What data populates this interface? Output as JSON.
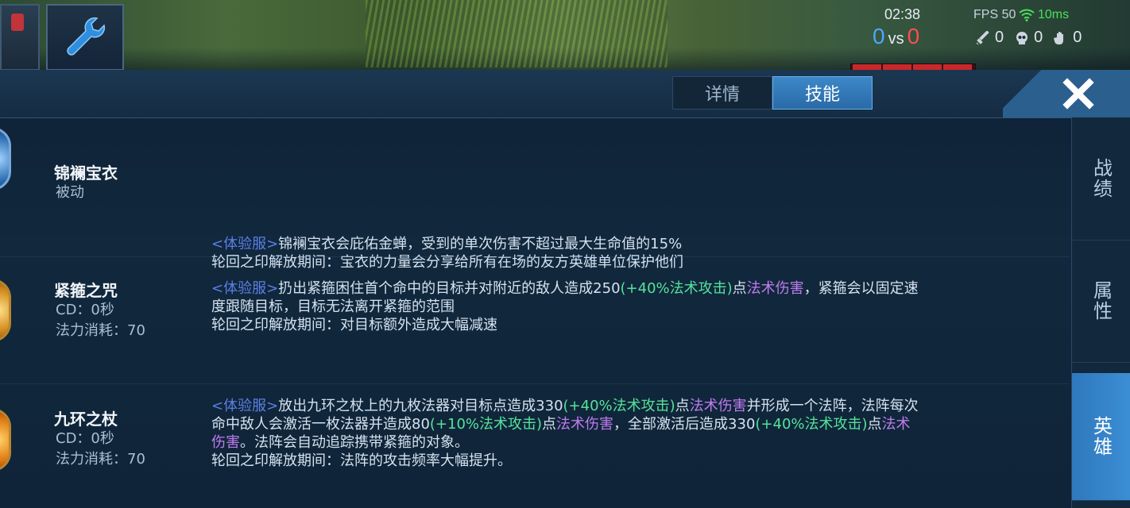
{
  "hud": {
    "time": "02:38",
    "fps": "FPS 50",
    "ping": "10ms",
    "score_blue": "0",
    "score_vs": "vs",
    "score_red": "0",
    "kills": "0",
    "deaths": "0",
    "assists": "0"
  },
  "tabs": {
    "details": "详情",
    "skills": "技能"
  },
  "side_tabs": {
    "record": "战绩",
    "attributes": "属性",
    "hero": "英雄"
  },
  "skills": [
    {
      "name": "锦襕宝衣",
      "type": "被动",
      "desc": [
        [
          {
            "t": "<体验服>",
            "c": "tag"
          },
          {
            "t": "锦襕宝衣会庇佑金蝉，受到的单次伤害不超过最大生命值的15%",
            "c": ""
          }
        ],
        [
          {
            "t": "轮回之印解放期间：宝衣的力量会分享给所有在场的友方英雄单位保护他们",
            "c": ""
          }
        ]
      ]
    },
    {
      "name": "紧箍之咒",
      "cd": "CD：0秒",
      "cost": "法力消耗：70",
      "desc": [
        [
          {
            "t": "<体验服>",
            "c": "tag"
          },
          {
            "t": "扔出紧箍困住首个命中的目标并对附近的敌人造成250",
            "c": ""
          },
          {
            "t": "(+40%法术攻击)",
            "c": "grn"
          },
          {
            "t": "点",
            "c": ""
          },
          {
            "t": "法术伤害",
            "c": "pur"
          },
          {
            "t": "，紧箍会以固定速",
            "c": ""
          }
        ],
        [
          {
            "t": "度跟随目标，目标无法离开紧箍的范围",
            "c": ""
          }
        ],
        [
          {
            "t": "轮回之印解放期间：对目标额外造成大幅减速",
            "c": ""
          }
        ]
      ]
    },
    {
      "name": "九环之杖",
      "cd": "CD：0秒",
      "cost": "法力消耗：70",
      "desc": [
        [
          {
            "t": "<体验服>",
            "c": "tag"
          },
          {
            "t": "放出九环之杖上的九枚法器对目标点造成330",
            "c": ""
          },
          {
            "t": "(+40%法术攻击)",
            "c": "grn"
          },
          {
            "t": "点",
            "c": ""
          },
          {
            "t": "法术伤害",
            "c": "pur"
          },
          {
            "t": "并形成一个法阵，法阵每次",
            "c": ""
          }
        ],
        [
          {
            "t": "命中敌人会激活一枚法器并造成80",
            "c": ""
          },
          {
            "t": "(+10%法术攻击)",
            "c": "grn"
          },
          {
            "t": "点",
            "c": ""
          },
          {
            "t": "法术伤害",
            "c": "pur"
          },
          {
            "t": "，全部激活后造成330",
            "c": ""
          },
          {
            "t": "(+40%法术攻击)",
            "c": "grn"
          },
          {
            "t": "点",
            "c": ""
          },
          {
            "t": "法术",
            "c": "pur"
          }
        ],
        [
          {
            "t": "伤害",
            "c": "pur"
          },
          {
            "t": "。法阵会自动追踪携带紧箍的对象。",
            "c": ""
          }
        ],
        [
          {
            "t": "轮回之印解放期间：法阵的攻击频率大幅提升。",
            "c": ""
          }
        ]
      ]
    }
  ]
}
